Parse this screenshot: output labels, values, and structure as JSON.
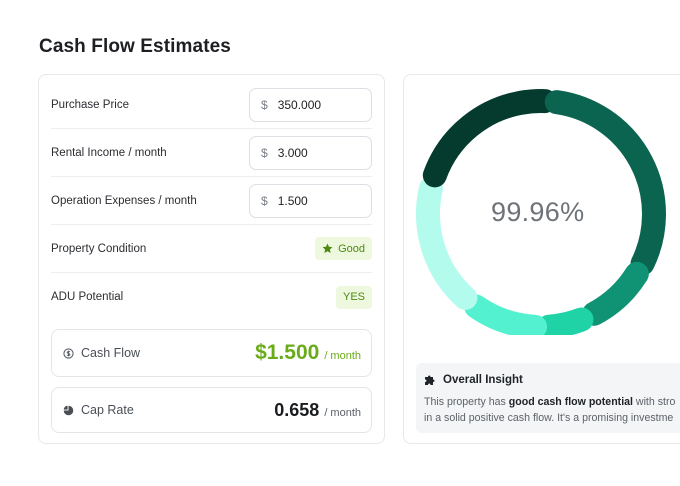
{
  "page": {
    "title": "Cash Flow Estimates"
  },
  "inputs": {
    "purchase_price": {
      "label": "Purchase Price",
      "currency": "$",
      "value": "350.000"
    },
    "rental_income": {
      "label": "Rental Income / month",
      "currency": "$",
      "value": "3.000"
    },
    "operation_expenses": {
      "label": "Operation Expenses / month",
      "currency": "$",
      "value": "1.500"
    }
  },
  "property_condition": {
    "label": "Property Condition",
    "badge": "Good",
    "icon": "star-icon"
  },
  "adu_potential": {
    "label": "ADU Potential",
    "badge": "YES"
  },
  "metrics": {
    "cash_flow": {
      "label": "Cash Flow",
      "value": "$1.500",
      "unit": "/ month",
      "icon": "cash-flow-icon"
    },
    "cap_rate": {
      "label": "Cap Rate",
      "value": "0.658",
      "unit": "/ month",
      "icon": "pie-chart-icon"
    }
  },
  "chart": {
    "center_value": "99.96%"
  },
  "insight": {
    "title": "Overall Insight",
    "icon": "puzzle-icon",
    "line1_pre": "This property has ",
    "line1_bold": "good cash flow potential",
    "line1_post": " with stro",
    "line2": "in a solid positive cash flow. It's a promising investme"
  },
  "colors": {
    "seg_dark": "#043b2e",
    "seg_main": "#0b6450",
    "seg_green": "#0f9374",
    "seg_teal": "#1fd3a7",
    "seg_mint": "#54f1d1",
    "seg_pale": "#b3fbed",
    "accent_green": "#6aab1a"
  }
}
